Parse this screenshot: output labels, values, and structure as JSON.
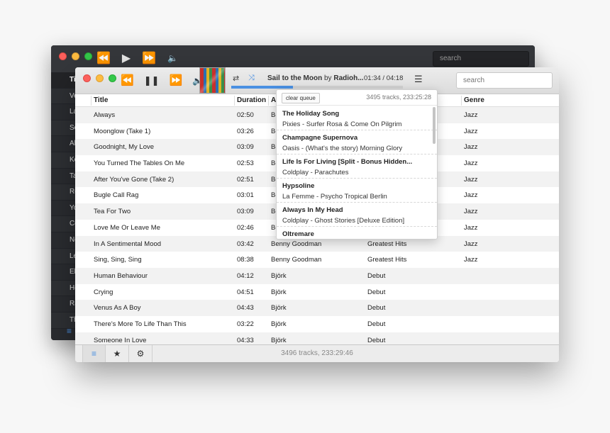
{
  "back_window": {
    "search_placeholder": "search",
    "column_letters": [
      "Ti",
      "Ve",
      "La",
      "Se",
      "Al",
      "Ko",
      "Ta",
      "Re",
      "Yo",
      "Co",
      "Ne",
      "Le",
      "El",
      "He",
      "Ra",
      "Th"
    ]
  },
  "player": {
    "now_playing_title": "Sail to the Moon",
    "now_playing_by": "by",
    "now_playing_artist": "Radioh...",
    "time": "01:34 / 04:18",
    "progress": 0.36,
    "search_placeholder": "search"
  },
  "table": {
    "headers": {
      "title": "Title",
      "duration": "Duration",
      "artist": "A",
      "album": "",
      "genre": "Genre"
    },
    "rows": [
      {
        "title": "Always",
        "duration": "02:50",
        "artist": "Be",
        "album": "",
        "genre": "Jazz"
      },
      {
        "title": "Moonglow (Take 1)",
        "duration": "03:26",
        "artist": "Be",
        "album": "",
        "genre": "Jazz"
      },
      {
        "title": "Goodnight, My Love",
        "duration": "03:09",
        "artist": "Be",
        "album": "",
        "genre": "Jazz"
      },
      {
        "title": "You Turned The Tables On Me",
        "duration": "02:53",
        "artist": "Be",
        "album": "",
        "genre": "Jazz"
      },
      {
        "title": "After You've Gone (Take 2)",
        "duration": "02:51",
        "artist": "Be",
        "album": "",
        "genre": "Jazz"
      },
      {
        "title": "Bugle Call Rag",
        "duration": "03:01",
        "artist": "Be",
        "album": "",
        "genre": "Jazz"
      },
      {
        "title": "Tea For Two",
        "duration": "03:09",
        "artist": "Be",
        "album": "",
        "genre": "Jazz"
      },
      {
        "title": "Love Me Or Leave Me",
        "duration": "02:46",
        "artist": "Be",
        "album": "",
        "genre": "Jazz"
      },
      {
        "title": "In A Sentimental Mood",
        "duration": "03:42",
        "artist": "Benny Goodman",
        "album": "Greatest Hits",
        "genre": "Jazz"
      },
      {
        "title": "Sing, Sing, Sing",
        "duration": "08:38",
        "artist": "Benny Goodman",
        "album": "Greatest Hits",
        "genre": "Jazz"
      },
      {
        "title": "Human Behaviour",
        "duration": "04:12",
        "artist": "Björk",
        "album": "Debut",
        "genre": ""
      },
      {
        "title": "Crying",
        "duration": "04:51",
        "artist": "Björk",
        "album": "Debut",
        "genre": ""
      },
      {
        "title": "Venus As A Boy",
        "duration": "04:43",
        "artist": "Björk",
        "album": "Debut",
        "genre": ""
      },
      {
        "title": "There's More To Life Than This",
        "duration": "03:22",
        "artist": "Björk",
        "album": "Debut",
        "genre": ""
      },
      {
        "title": "Someone In Love",
        "duration": "04:33",
        "artist": "Björk",
        "album": "Debut",
        "genre": ""
      }
    ]
  },
  "status_text": "3496 tracks, 233:29:46",
  "queue": {
    "clear_label": "clear queue",
    "count_text": "3495 tracks, 233:25:28",
    "items": [
      {
        "title": "The Holiday Song",
        "subtitle": "Pixies - Surfer Rosa & Come On Pilgrim"
      },
      {
        "title": "Champagne Supernova",
        "subtitle": "Oasis - (What's the story) Morning Glory"
      },
      {
        "title": "Life Is For Living [Split - Bonus Hidden...",
        "subtitle": "Coldplay - Parachutes"
      },
      {
        "title": "Hypsoline",
        "subtitle": "La Femme - Psycho Tropical Berlin"
      },
      {
        "title": "Always In My Head",
        "subtitle": "Coldplay - Ghost Stories [Deluxe Edition]"
      },
      {
        "title": "Oltremare",
        "subtitle": ""
      }
    ]
  },
  "icons": {
    "rewind": "⏪",
    "play": "▶",
    "pause": "❚❚",
    "forward": "⏩",
    "volume": "🔈",
    "repeat": "⇄",
    "shuffle": "⤨",
    "queue_list": "☰",
    "list": "≡",
    "star": "★",
    "gear": "⚙"
  },
  "colors": {
    "accent": "#4a90e2",
    "back_bg": "#2a2c30"
  }
}
